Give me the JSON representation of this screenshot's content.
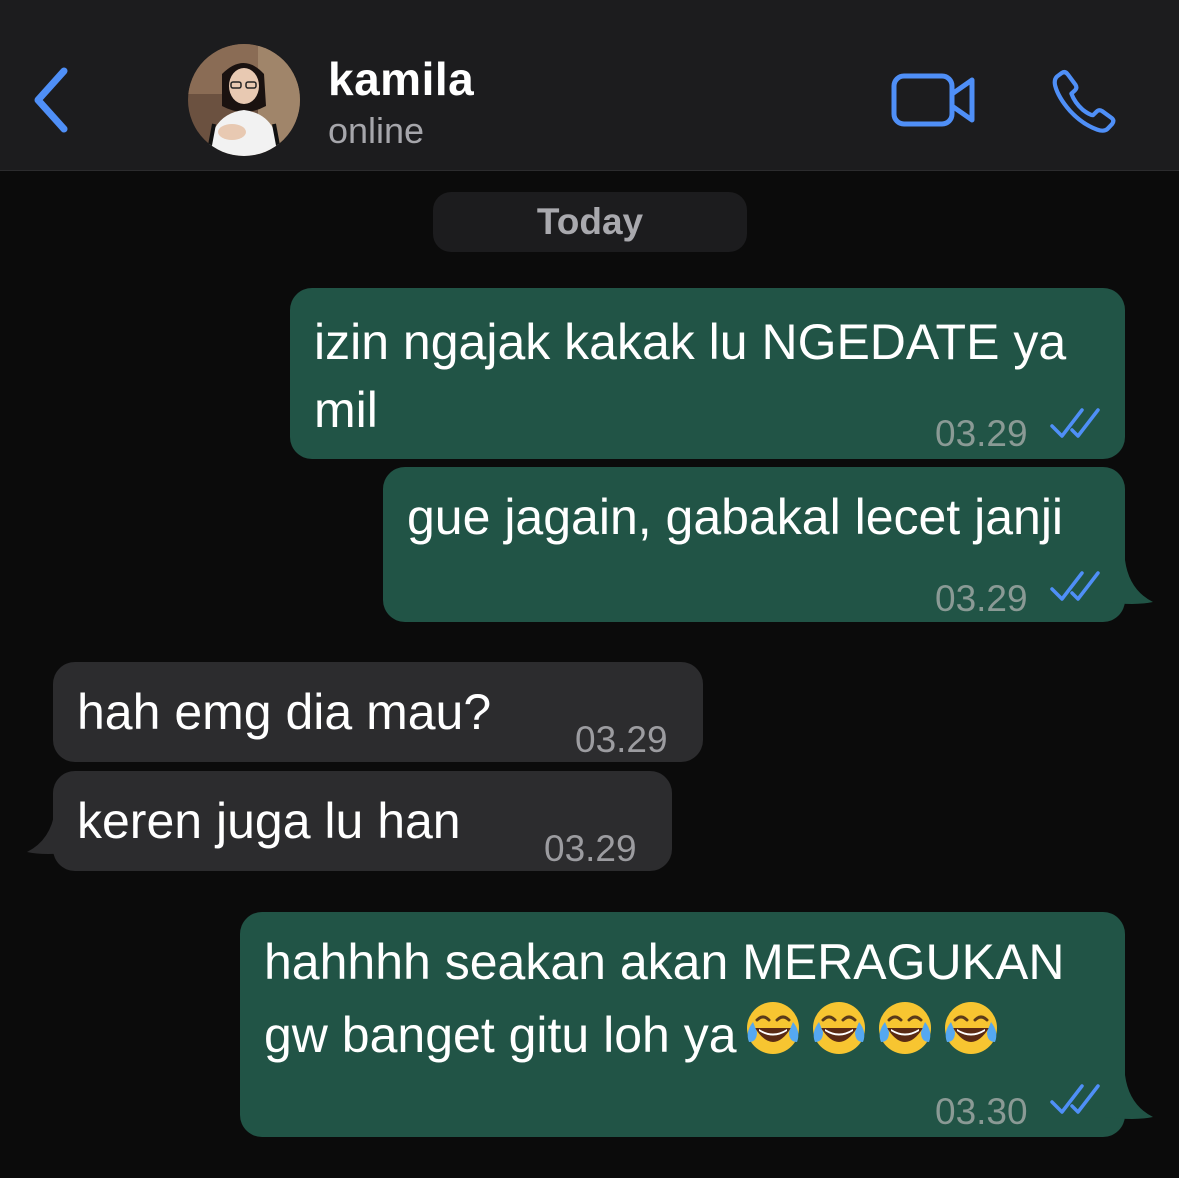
{
  "header": {
    "contact_name": "kamila",
    "status": "online",
    "icons": {
      "back": "chevron-left-icon",
      "video": "video-camera-icon",
      "call": "phone-icon"
    },
    "accent_color": "#4f8ff7"
  },
  "date_separator": "Today",
  "messages": [
    {
      "direction": "outgoing",
      "lines": [
        "izin ngajak kakak lu NGEDATE ya",
        "mil"
      ],
      "time": "03.29",
      "status": "read"
    },
    {
      "direction": "outgoing",
      "lines": [
        "gue jagain, gabakal lecet janji"
      ],
      "time": "03.29",
      "status": "read"
    },
    {
      "direction": "incoming",
      "lines": [
        "hah emg dia mau?"
      ],
      "time": "03.29"
    },
    {
      "direction": "incoming",
      "lines": [
        "keren juga lu han"
      ],
      "time": "03.29"
    },
    {
      "direction": "outgoing",
      "lines": [
        "hahhhh seakan akan MERAGUKAN",
        "gw banget gitu loh ya"
      ],
      "emoji": "face-with-tears-of-joy",
      "emoji_count": 4,
      "time": "03.30",
      "status": "read"
    }
  ],
  "colors": {
    "outgoing_bubble": "#215446",
    "incoming_bubble": "#2c2c2e",
    "background": "#0b0b0b",
    "header": "#1c1c1e",
    "read_ticks": "#4f8ff7"
  }
}
